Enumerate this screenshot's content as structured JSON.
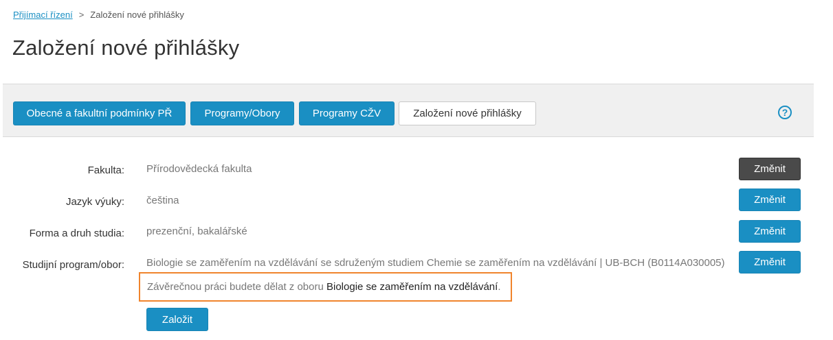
{
  "breadcrumb": {
    "root_link": "Přijímací řízení",
    "separator": ">",
    "current": "Založení nové přihlášky"
  },
  "page": {
    "title": "Založení nové přihlášky"
  },
  "tabs": [
    {
      "label": "Obecné a fakultní podmínky PŘ",
      "active": false
    },
    {
      "label": "Programy/Obory",
      "active": false
    },
    {
      "label": "Programy CŽV",
      "active": false
    },
    {
      "label": "Založení nové přihlášky",
      "active": true
    }
  ],
  "help": {
    "icon": "help-circle-icon",
    "glyph": "?"
  },
  "form": {
    "rows": [
      {
        "label": "Fakulta:",
        "value": "Přírodovědecká fakulta",
        "button": "Změnit"
      },
      {
        "label": "Jazyk výuky:",
        "value": "čeština",
        "button": "Změnit"
      },
      {
        "label": "Forma a druh studia:",
        "value": "prezenční, bakalářské",
        "button": "Změnit"
      },
      {
        "label": "Studijní program/obor:",
        "value": "Biologie se zaměřením na vzdělávání se sdruženým studiem Chemie se zaměřením na vzdělávání | UB-BCH (B0114A030005)",
        "button": "Změnit"
      }
    ],
    "notice": {
      "prefix": "Závěrečnou práci budete dělat z oboru ",
      "highlight": "Biologie se zaměřením na vzdělávání",
      "suffix": "."
    },
    "submit": "Založit"
  },
  "colors": {
    "accent": "#1a8fc3",
    "dark_button": "#4a4a4a",
    "notice_border": "#f0842c",
    "toolbar_bg": "#f0f0f0"
  }
}
